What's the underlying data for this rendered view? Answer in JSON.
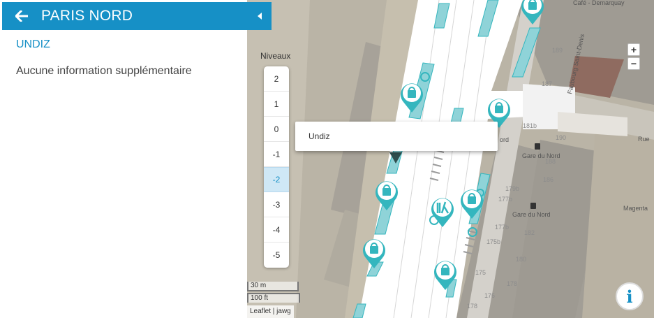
{
  "panel": {
    "station": "PARIS NORD",
    "store": "UNDIZ",
    "info": "Aucune information supplémentaire"
  },
  "map": {
    "levels_label": "Niveaux",
    "levels": [
      "2",
      "1",
      "0",
      "-1",
      "-2",
      "-3",
      "-4",
      "-5"
    ],
    "active_level": "-2",
    "zoom_in": "+",
    "zoom_out": "−",
    "popup": "Undiz",
    "scale_metric": "30 m",
    "scale_imperial": "100 ft",
    "attribution": "Leaflet | jawg",
    "info_glyph": "i",
    "labels": {
      "cafe": "Café - Demarquay",
      "street": "Faubourg Saint-Denis",
      "rue": "Rue",
      "gare1": "Gare du Nord",
      "gare2": "Gare du Nord",
      "nord": "ord",
      "magenta": "Magenta"
    },
    "street_numbers": [
      "189",
      "187",
      "181b",
      "190",
      "188",
      "186",
      "179b",
      "177b",
      "177b",
      "182",
      "175b",
      "180",
      "175",
      "178",
      "178",
      "176"
    ]
  },
  "colors": {
    "accent": "#1690c6",
    "teal": "#34b6be",
    "map_bg": "#bdb7a9"
  }
}
